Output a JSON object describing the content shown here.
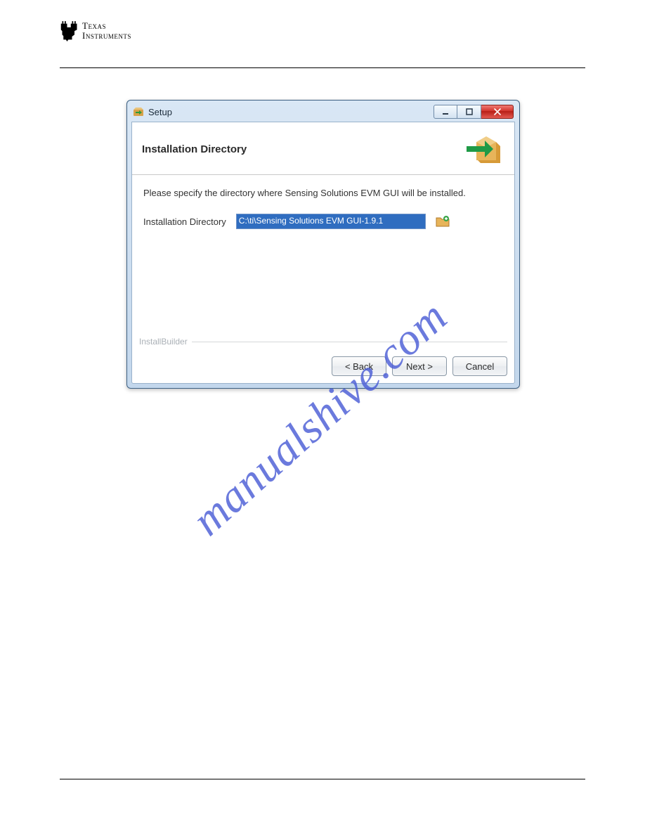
{
  "brand": {
    "line1": "Texas",
    "line2": "Instruments"
  },
  "watermark": "manualshive.com",
  "installer": {
    "window_title": "Setup",
    "header_title": "Installation Directory",
    "prompt": "Please specify the directory where Sensing Solutions EVM GUI will be installed.",
    "field_label": "Installation Directory",
    "field_value": "C:\\ti\\Sensing Solutions EVM GUI-1.9.1",
    "builder_label": "InstallBuilder",
    "buttons": {
      "back": "< Back",
      "next": "Next >",
      "cancel": "Cancel"
    }
  }
}
